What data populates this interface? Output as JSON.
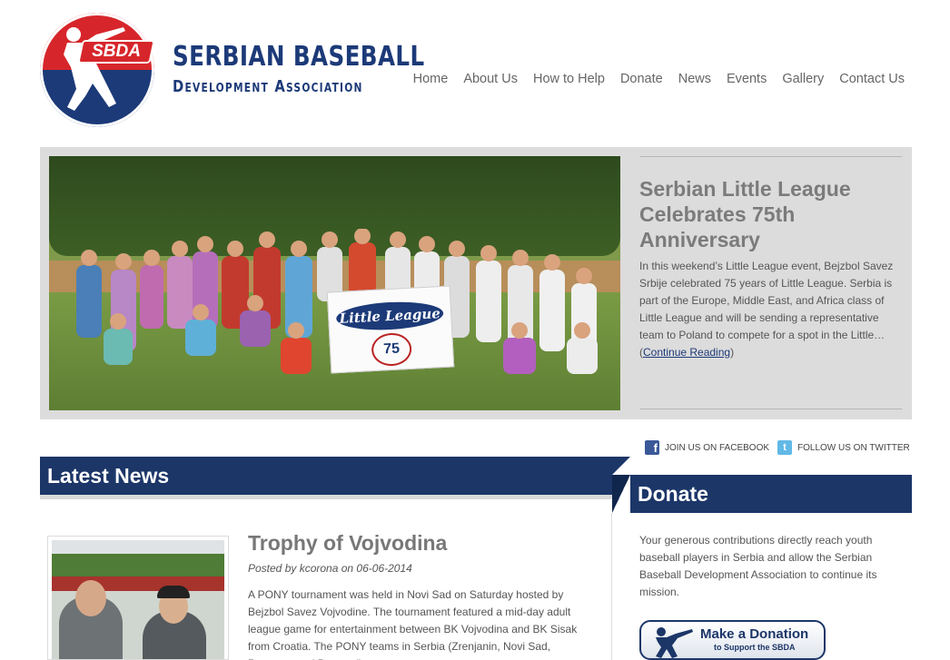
{
  "header": {
    "logo_text": "SBDA",
    "brand_line1": "SERBIAN BASEBALL",
    "brand_line2": "Development Association"
  },
  "nav": {
    "items": [
      {
        "label": "Home"
      },
      {
        "label": "About Us"
      },
      {
        "label": "How to Help"
      },
      {
        "label": "Donate"
      },
      {
        "label": "News"
      },
      {
        "label": "Events"
      },
      {
        "label": "Gallery"
      },
      {
        "label": "Contact Us"
      }
    ]
  },
  "slider": {
    "title": "Serbian Little League Celebrates 75th Anniversary",
    "text": "In this weekend’s Little League event, Bejzbol Savez Srbije celebrated 75 years of Little League. Serbia is part of the Europe, Middle East, and Africa class of Little League and will be sending a representative team to Poland to compete for a spot in the Little…(",
    "link": "Continue Reading",
    "after_link": ")",
    "banner_text": "Little League",
    "banner_number": "75"
  },
  "social": {
    "facebook_label": "JOIN US ON FACEBOOK",
    "twitter_label": "FOLLOW US ON TWITTER",
    "facebook_glyph": "f",
    "twitter_glyph": "t"
  },
  "latest_news": {
    "heading": "Latest News",
    "post": {
      "title": "Trophy of Vojvodina",
      "meta_prefix": "Posted by ",
      "author": "kcorona",
      "meta_mid": " on ",
      "date": "06-06-2014",
      "text": "A PONY tournament was held in Novi Sad on Saturday hosted by Bejzbol Savez Vojvodine. The tournament featured a mid-day adult league game for entertainment between BK Vojvodina and BK Sisak from Croatia. The PONY teams in Serbia (Zrenjanin, Novi Sad, Pancevo, and Beograd)..."
    }
  },
  "donate": {
    "heading": "Donate",
    "text": "Your generous contributions directly reach youth baseball players in Serbia and allow the Serbian Baseball Development Association to continue its mission.",
    "button_line1": "Make a Donation",
    "button_line2": "to Support the SBDA"
  },
  "colors": {
    "navy": "#1c3668",
    "red": "#d7262b",
    "slider_bg": "#dcdcdc"
  }
}
